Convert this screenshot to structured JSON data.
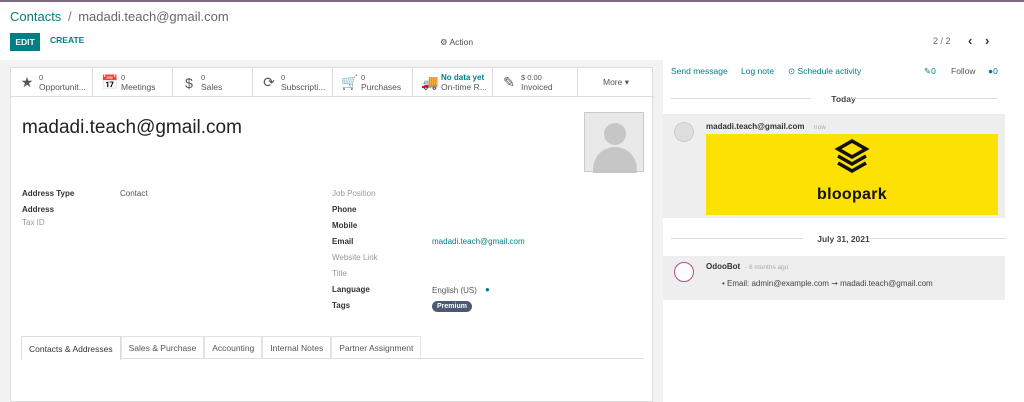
{
  "breadcrumb": {
    "parent": "Contacts",
    "separator": "/",
    "current": "madadi.teach@gmail.com"
  },
  "control": {
    "edit": "EDIT",
    "create": "CREATE",
    "action": "⚙ Action",
    "pager": "2 / 2",
    "prev": "‹",
    "next": "›"
  },
  "stats": [
    {
      "icon": "★",
      "num": "0",
      "label": "Opportunit..."
    },
    {
      "icon": "📅",
      "num": "0",
      "label": "Meetings"
    },
    {
      "icon": "$",
      "num": "0",
      "label": "Sales"
    },
    {
      "icon": "⟳",
      "num": "0",
      "label": "Subscripti..."
    },
    {
      "icon": "🛒",
      "num": "0",
      "label": "Purchases"
    },
    {
      "icon": "🚚",
      "num": "No data yet",
      "label": "On-time R..."
    },
    {
      "icon": "✎",
      "num": "$ 0.00",
      "label": "Invoiced"
    }
  ],
  "more": "More ▾",
  "record": {
    "name": "madadi.teach@gmail.com",
    "address_type_label": "Address Type",
    "address_type": "Contact",
    "address_label": "Address",
    "taxid_label": "Tax ID",
    "job_label": "Job Position",
    "phone_label": "Phone",
    "mobile_label": "Mobile",
    "email_label": "Email",
    "email": "madadi.teach@gmail.com",
    "website_label": "Website Link",
    "title_label": "Title",
    "language_label": "Language",
    "language": "English (US)",
    "tags_label": "Tags",
    "tag": "Premium"
  },
  "tabs": [
    "Contacts & Addresses",
    "Sales & Purchase",
    "Accounting",
    "Internal Notes",
    "Partner Assignment"
  ],
  "chatter": {
    "send": "Send message",
    "note": "Log note",
    "schedule": "⊙ Schedule activity",
    "attach": "0",
    "follow": "Follow",
    "followers": "0",
    "today": "Today",
    "date2": "July 31, 2021",
    "msg1_author": "madadi.teach@gmail.com",
    "msg1_ago": "now",
    "banner_text": "bloopark",
    "msg2_author": "OdooBot",
    "msg2_ago": "- 6 months ago",
    "msg2_text": "Email: admin@example.com ➞ madadi.teach@gmail.com"
  },
  "colors": {
    "accent": "#017e84",
    "banner": "#fde102",
    "tag": "#4b5a72"
  }
}
